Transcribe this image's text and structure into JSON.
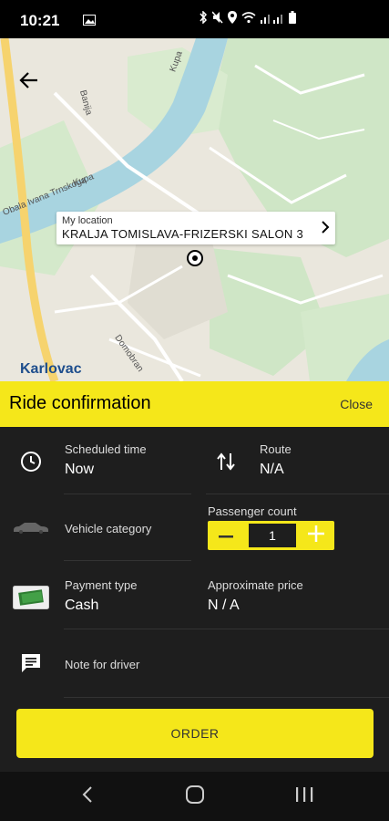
{
  "status_bar": {
    "time": "10:21",
    "icons": [
      "gallery-icon",
      "bluetooth-icon",
      "mute-icon",
      "location-icon",
      "wifi-icon",
      "signal-icon",
      "battery-icon"
    ]
  },
  "map": {
    "labels": {
      "kupa_upper": "Kupa",
      "banija": "Banija",
      "obala": "Obala Ivana Trnskoga",
      "kupa_lower": "Kupa",
      "domobran": "Domobran",
      "city": "Karlovac"
    },
    "location_card": {
      "label": "My location",
      "value": "KRALJA TOMISLAVA-FRIZERSKI SALON 3"
    }
  },
  "header": {
    "title": "Ride confirmation",
    "close_label": "Close"
  },
  "ride": {
    "scheduled_time_label": "Scheduled time",
    "scheduled_time_value": "Now",
    "route_label": "Route",
    "route_value": "N/A",
    "vehicle_category_label": "Vehicle category",
    "passenger_count_label": "Passenger count",
    "passenger_count_value": "1",
    "payment_type_label": "Payment type",
    "payment_type_value": "Cash",
    "price_label": "Approximate price",
    "price_value": "N / A",
    "note_label": "Note for driver"
  },
  "order_label": "ORDER",
  "colors": {
    "accent": "#f5e71a",
    "sheet_bg": "#1e1e1e",
    "map_water": "#a8d4e0",
    "map_road": "#f6d36e"
  }
}
